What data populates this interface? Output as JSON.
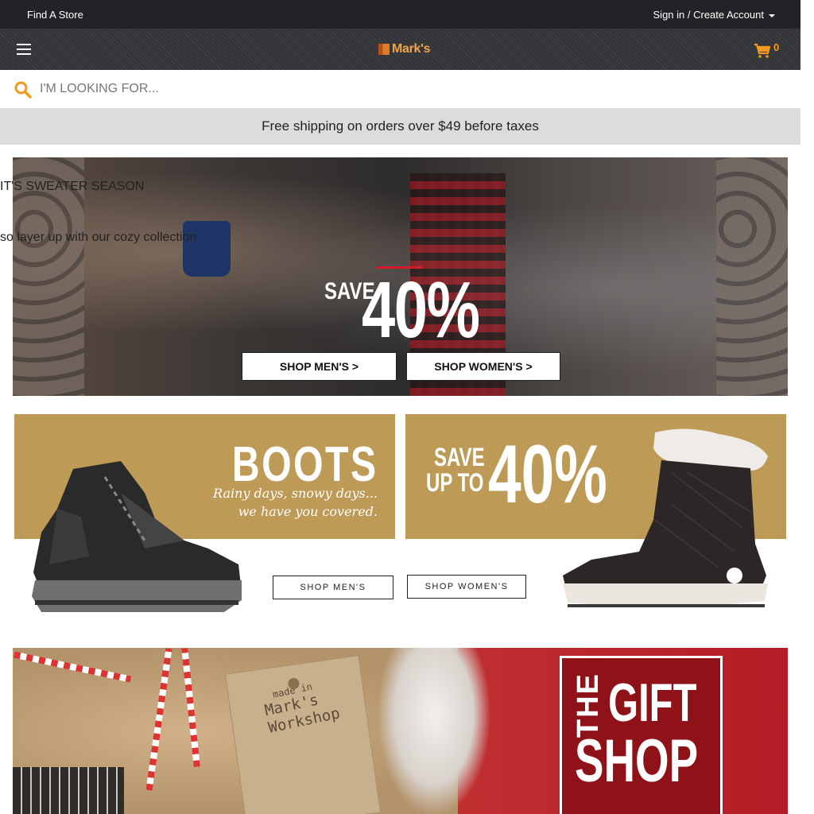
{
  "topbar": {
    "find_store": "Find A Store",
    "account": "Sign in / Create Account"
  },
  "header": {
    "logo_text": "Mark's",
    "cart_count": "0",
    "brand_color": "#f0a34a"
  },
  "search": {
    "placeholder": "I'M LOOKING FOR..."
  },
  "promo": {
    "text": "Free shipping on orders over $49 before taxes"
  },
  "hero": {
    "title": "IT'S SWEATER SEASON",
    "subtitle": "so layer up with our cozy collection",
    "save_label": "SAVE",
    "save_value": "40%",
    "shop_men": "SHOP MEN'S >",
    "shop_women": "SHOP WOMEN'S >"
  },
  "boots": {
    "title": "BOOTS",
    "line1": "Rainy days, snowy days...",
    "line2": "we have you covered.",
    "save_line1": "SAVE",
    "save_line2": "UP TO",
    "save_value": "40%",
    "shop_men": "SHOP MEN'S",
    "shop_women": "SHOP WOMEN'S",
    "panel_color": "#bd9a56"
  },
  "gift": {
    "tag_line1": "made in",
    "tag_line2": "Mark's",
    "tag_line3": "Workshop",
    "the": "THE",
    "gift": "GIFT",
    "shop": "SHOP",
    "accent_color": "#8f1218"
  }
}
